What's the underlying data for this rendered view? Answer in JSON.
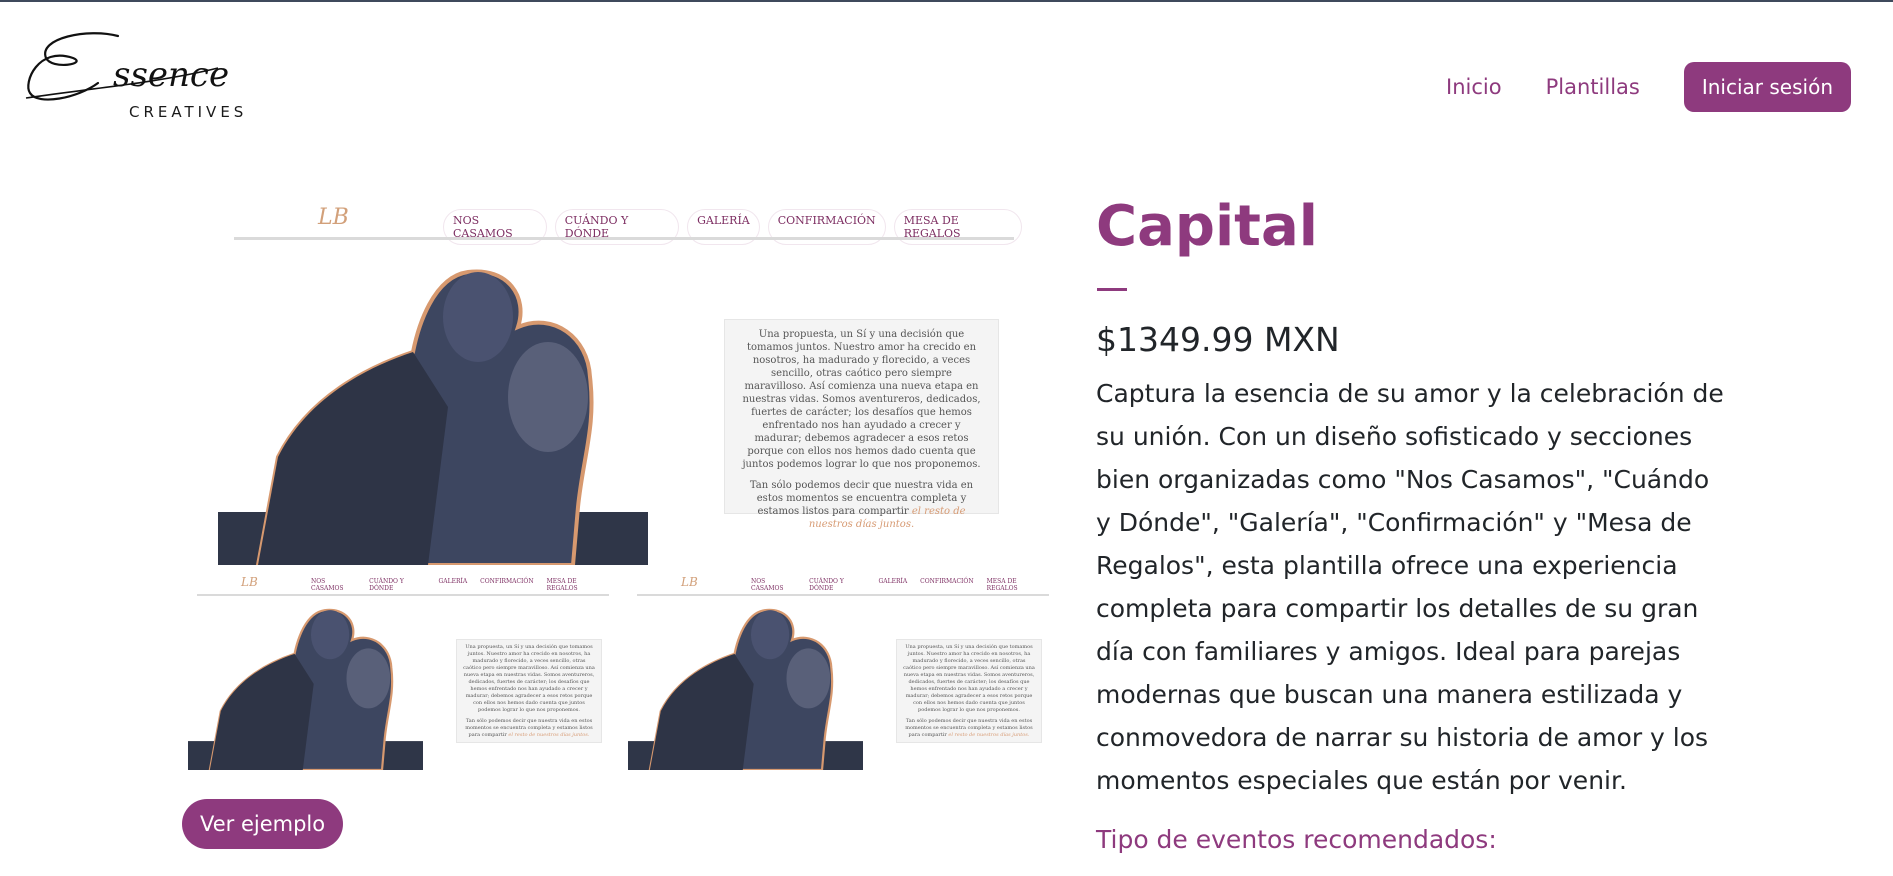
{
  "logo": {
    "script": "Essence",
    "subtitle": "CREATIVES"
  },
  "nav": {
    "items": [
      "Inicio",
      "Plantillas"
    ],
    "login": "Iniciar sesión"
  },
  "preview": {
    "monogram": "LB",
    "nav_items": [
      "NOS CASAMOS",
      "CUÁNDO Y DÓNDE",
      "GALERÍA",
      "CONFIRMACIÓN",
      "MESA DE REGALOS"
    ],
    "paragraph1": "Una propuesta, un Sí y una decisión que tomamos juntos. Nuestro amor ha crecido en nosotros, ha madurado y florecido, a veces sencillo, otras caótico pero siempre maravilloso. Así comienza una nueva etapa en nuestras vidas. Somos aventureros, dedicados, fuertes de carácter; los desafíos que hemos enfrentado nos han ayudado a crecer y madurar; debemos agradecer a esos retos porque con ellos nos hemos dado cuenta que juntos podemos lograr lo que nos proponemos.",
    "paragraph2": "Tan sólo podemos decir que nuestra vida en estos momentos se encuentra completa y estamos listos para compartir",
    "paragraph2_accent": "el resto de nuestros días juntos."
  },
  "example_button": "Ver ejemplo",
  "product": {
    "title": "Capital",
    "price": "$1349.99 MXN",
    "description": "Captura la esencia de su amor y la celebración de su unión. Con un diseño sofisticado y secciones bien organizadas como \"Nos Casamos\", \"Cuándo y Dónde\", \"Galería\", \"Confirmación\" y \"Mesa de Regalos\", esta plantilla ofrece una experiencia completa para compartir los detalles de su gran día con familiares y amigos. Ideal para parejas modernas que buscan una manera estilizada y conmovedora de narrar su historia de amor y los momentos especiales que están por venir.",
    "events_heading": "Tipo de eventos recomendados:"
  },
  "colors": {
    "brand": "#8e3a7e",
    "photo_tint": "#3d4660",
    "photo_outline": "#d7996f"
  }
}
